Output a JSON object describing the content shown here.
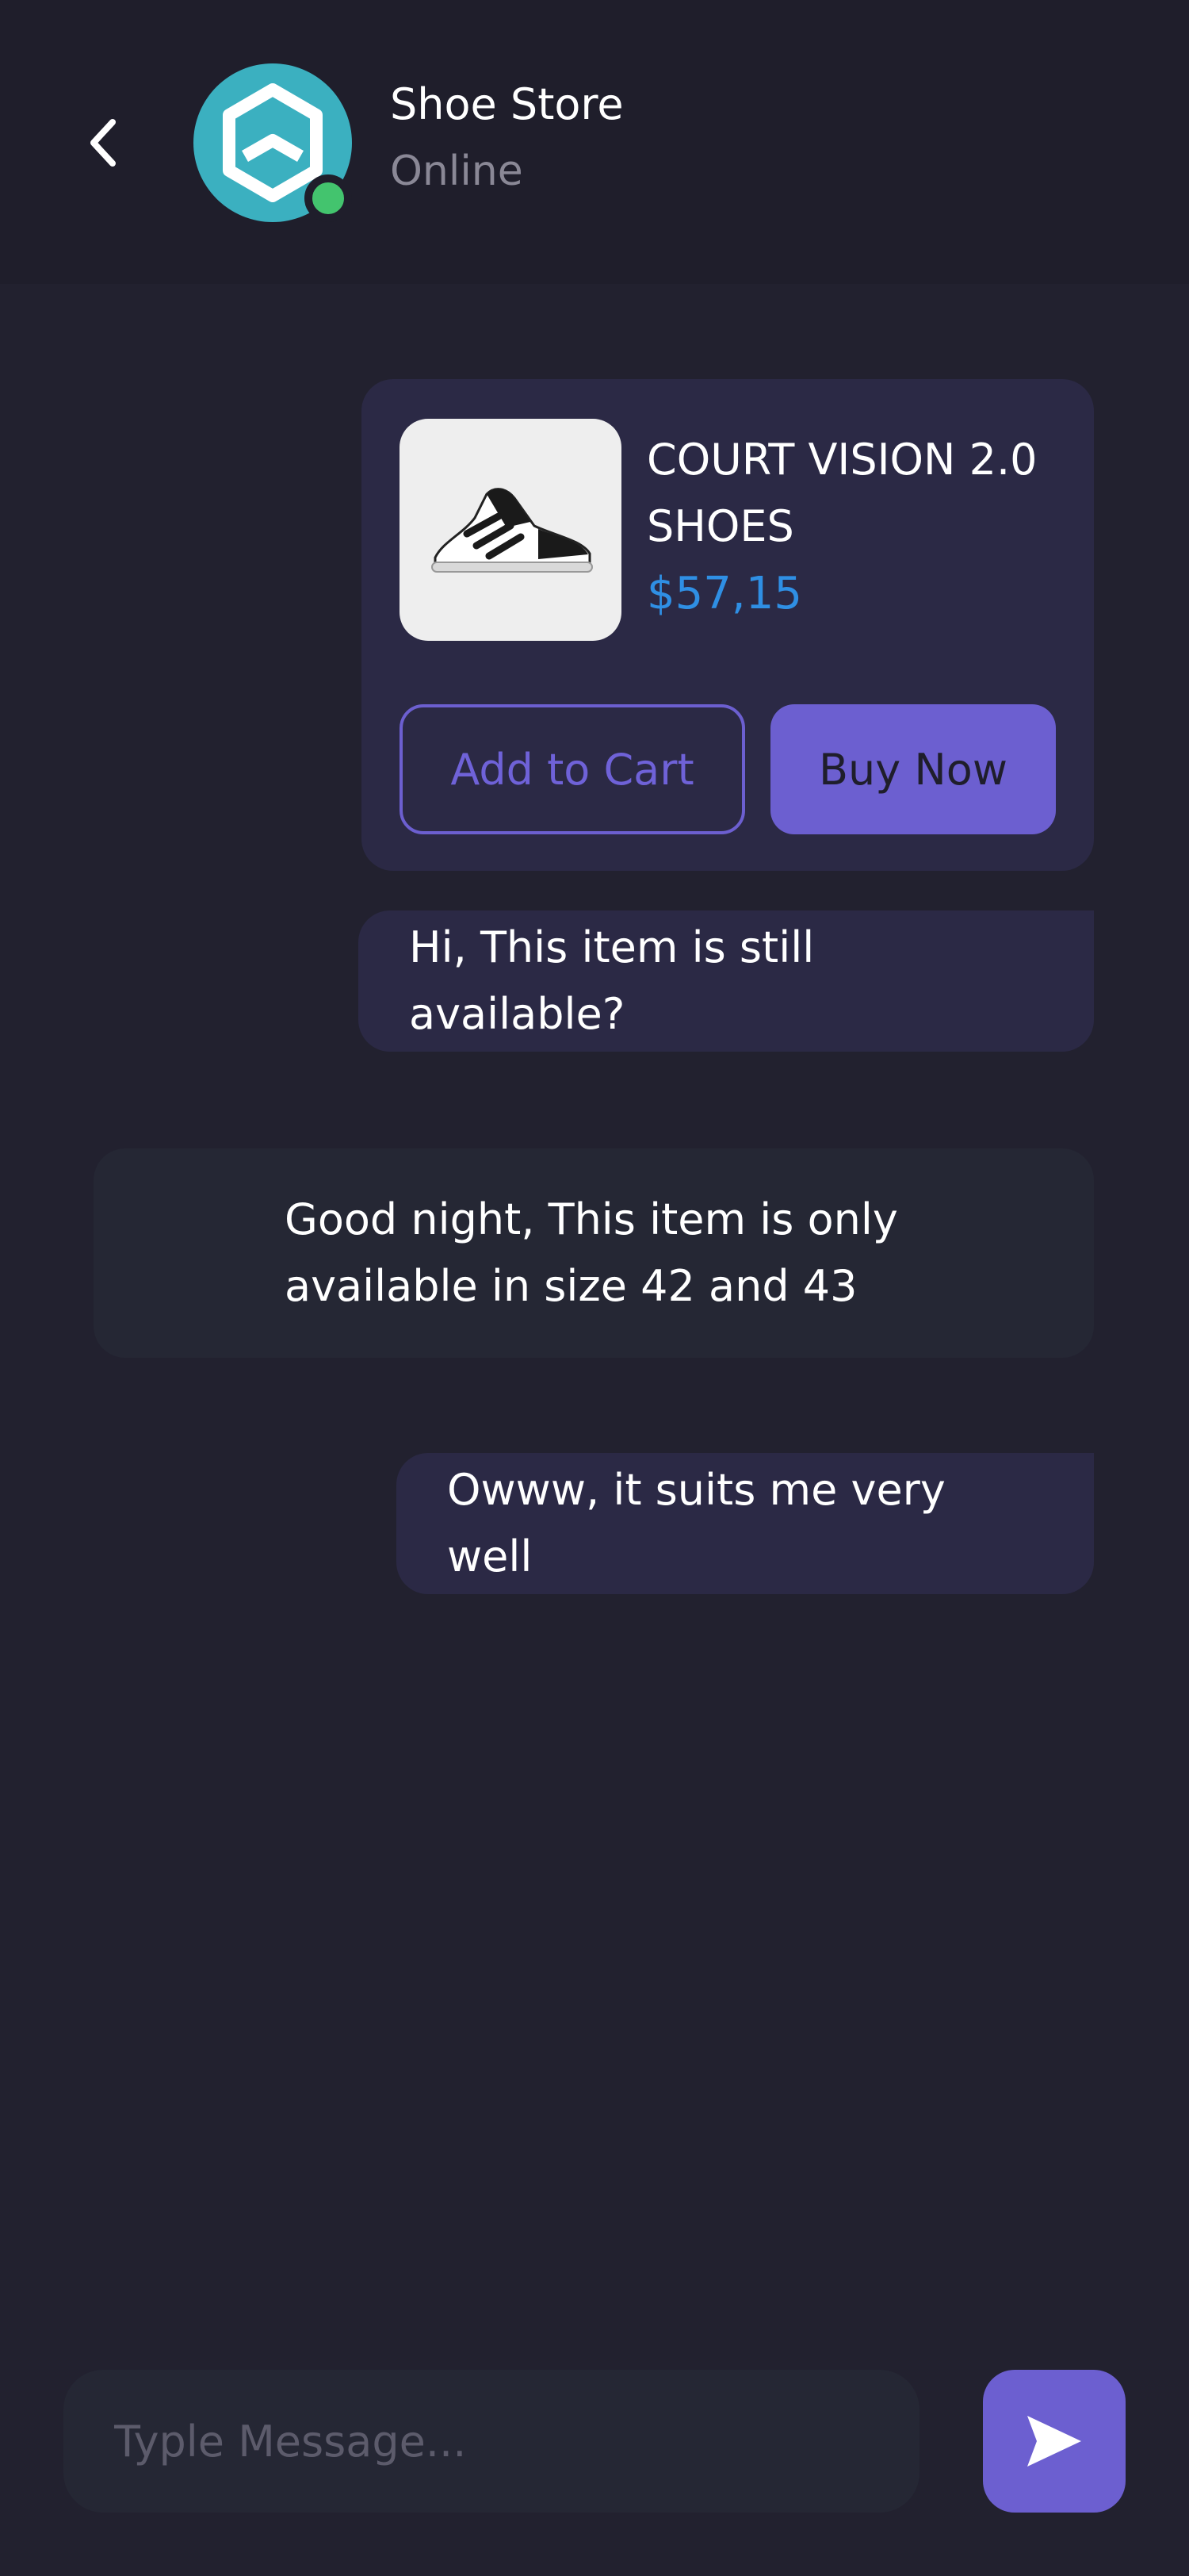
{
  "header": {
    "back_icon": "chevron-left-icon",
    "store_name": "Shoe Store",
    "status": "Online",
    "avatar_icon": "cube-logo-icon"
  },
  "product": {
    "title": "COURT VISION 2.0 SHOES",
    "price": "$57,15",
    "add_to_cart_label": "Add to Cart",
    "buy_now_label": "Buy Now",
    "image_icon": "sneaker-icon"
  },
  "messages": [
    {
      "from": "me",
      "text": "Hi, This item is still available?"
    },
    {
      "from": "store",
      "text": "Good night, This item is only available in size 42 and 43"
    },
    {
      "from": "me",
      "text": "Owww, it suits me very well"
    }
  ],
  "composer": {
    "placeholder": "Typle Message...",
    "send_icon": "send-icon"
  },
  "colors": {
    "background": "#22212f",
    "header": "#1f1e2b",
    "accent": "#6c5fd0",
    "price": "#2f8fe4",
    "online": "#43c46e",
    "avatar": "#3bb0c0"
  }
}
